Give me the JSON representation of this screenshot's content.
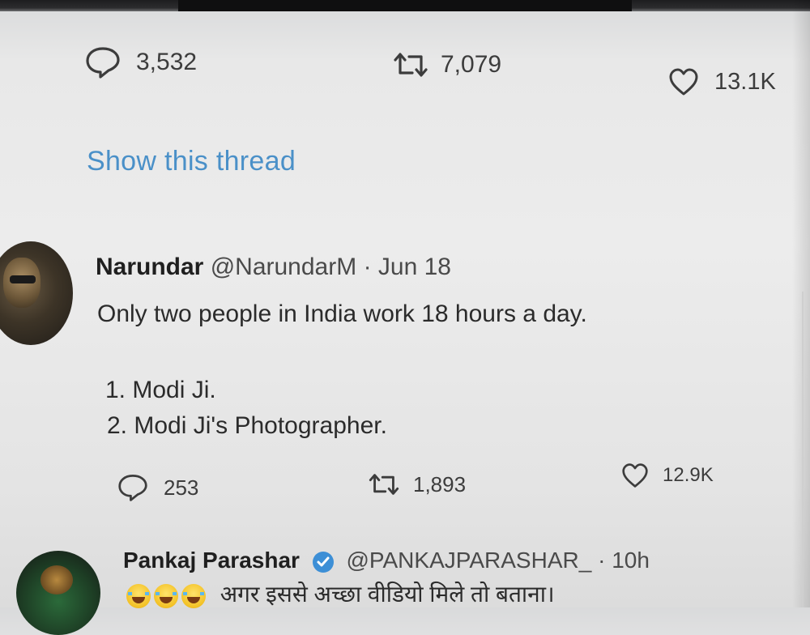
{
  "top_tweet_actions": {
    "reply_count": "3,532",
    "retweet_count": "7,079",
    "like_count": "13.1K"
  },
  "show_thread": "Show this thread",
  "tweet": {
    "name": "Narundar",
    "handle": "@NarundarM",
    "separator": "·",
    "date": "Jun 18",
    "line1": "Only two people in India work 18 hours a day.",
    "line2": "1. Modi Ji.",
    "line3": "2. Modi Ji's Photographer.",
    "reply_count": "253",
    "retweet_count": "1,893",
    "like_count": "12.9K"
  },
  "next_tweet": {
    "name": "Pankaj Parashar",
    "handle": "@PANKAJPARASHAR_",
    "separator": "·",
    "time": "10h",
    "text": "अगर इससे अच्छा वीडियो मिले तो बताना।"
  },
  "colors": {
    "link": "#4a90c8",
    "text": "#2b2b2b",
    "verified": "#3d8fd6"
  },
  "icons": [
    "reply-icon",
    "retweet-icon",
    "like-icon",
    "verified-badge-icon",
    "laughing-emoji-icon"
  ]
}
